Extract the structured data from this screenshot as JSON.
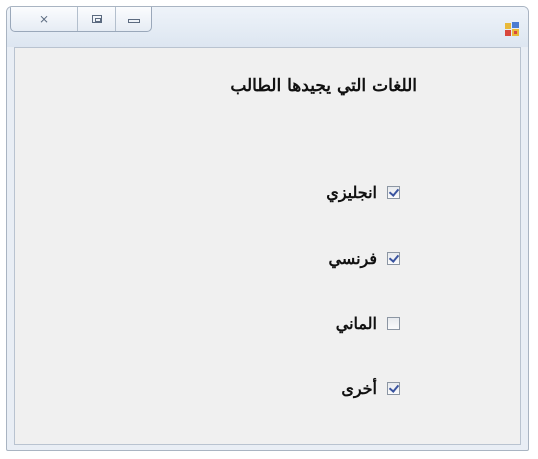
{
  "window": {
    "buttons": {
      "close": "close-icon",
      "maximize": "maximize-icon",
      "minimize": "minimize-icon"
    },
    "app_icon": "app-icon"
  },
  "form": {
    "heading": "اللغات التي يجيدها الطالب",
    "options": [
      {
        "label": "انجليزي",
        "checked": true
      },
      {
        "label": "فرنسي",
        "checked": true
      },
      {
        "label": "الماني",
        "checked": false
      },
      {
        "label": "أخرى",
        "checked": true
      }
    ]
  },
  "colors": {
    "window_bg": "#e9eef5",
    "client_bg": "#f0f0f0",
    "check_mark": "#3a54a0"
  }
}
